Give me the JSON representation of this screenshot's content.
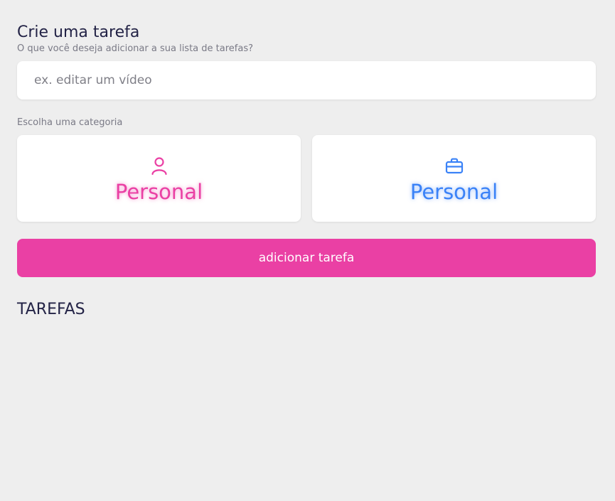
{
  "form": {
    "title": "Crie uma tarefa",
    "subtitle": "O que você deseja adicionar a sua lista de tarefas?",
    "input_placeholder": "ex. editar um vídeo",
    "input_value": "",
    "category_label": "Escolha uma categoria",
    "categories": [
      {
        "label": "Personal",
        "icon": "user-icon",
        "color": "#ea40a4"
      },
      {
        "label": "Personal",
        "icon": "briefcase-icon",
        "color": "#3a82f7"
      }
    ],
    "submit_label": "adicionar tarefa"
  },
  "tasks": {
    "heading": "TAREFAS"
  },
  "colors": {
    "background": "#eeeeee",
    "accent": "#ea40a4",
    "secondary": "#3a82f7",
    "heading": "#232346"
  }
}
